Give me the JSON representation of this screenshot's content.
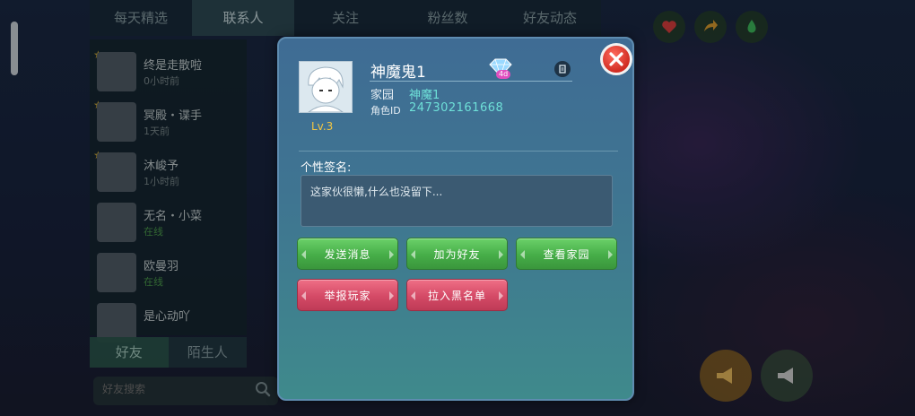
{
  "background": {
    "top_tabs": [
      {
        "label": "每天精选",
        "active": false
      },
      {
        "label": "联系人",
        "active": true
      },
      {
        "label": "关注",
        "active": false
      },
      {
        "label": "粉丝数",
        "active": false
      },
      {
        "label": "好友动态",
        "active": false
      }
    ],
    "contacts": [
      {
        "name": "终是走散啦",
        "status": "0小时前",
        "online": false
      },
      {
        "name": "冥殿・谍手",
        "status": "1天前",
        "online": false
      },
      {
        "name": "沐峻予",
        "status": "1小时前",
        "online": false
      },
      {
        "name": "无名・小菜",
        "status": "在线",
        "online": true
      },
      {
        "name": "欧曼羽",
        "status": "在线",
        "online": true
      },
      {
        "name": "是心动吖",
        "status": "",
        "online": false
      }
    ],
    "bottom_tabs": [
      {
        "label": "好友",
        "active": true
      },
      {
        "label": "陌生人",
        "active": false
      }
    ],
    "search": {
      "placeholder": "好友搜索"
    }
  },
  "profile": {
    "name": "神魔鬼1",
    "level": "Lv.3",
    "home_label": "家园",
    "home_value": "神魔1",
    "id_label": "角色ID",
    "id_value": "247302161668",
    "signature_label": "个性签名:",
    "signature_text": "这家伙很懒,什么也没留下...",
    "vip_badge_text": "4d"
  },
  "actions": {
    "send_message": "发送消息",
    "add_friend": "加为好友",
    "view_home": "查看家园",
    "report_player": "举报玩家",
    "add_blacklist": "拉入黑名单"
  },
  "colors": {
    "modal_top": "#3f6c94",
    "modal_bottom": "#3f8a8c",
    "green_button": "#46ad48",
    "pink_button": "#d44a66",
    "accent_cyan": "#6ee0d8",
    "level_gold": "#f2c542",
    "close_red": "#d02c22"
  }
}
